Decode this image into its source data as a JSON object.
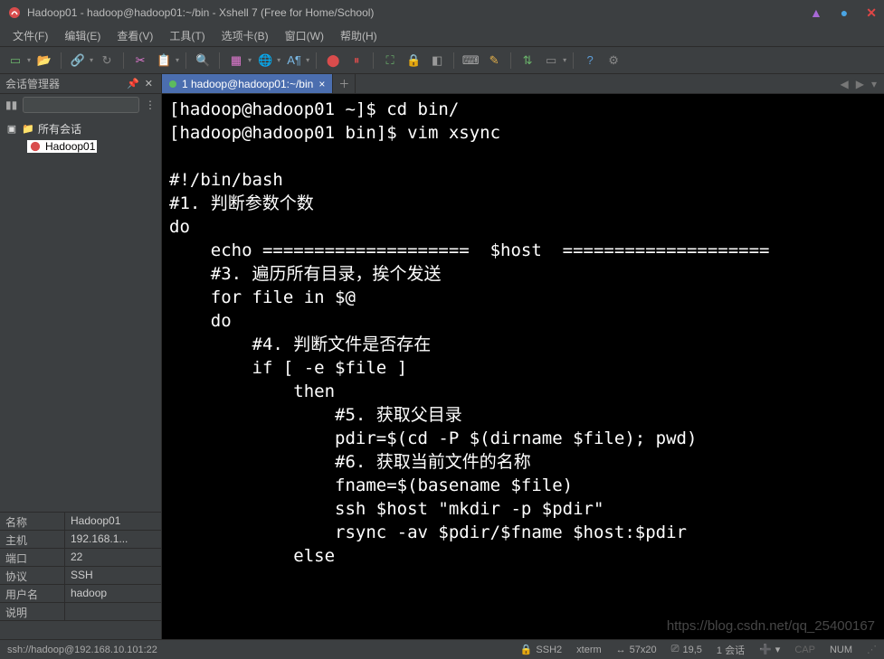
{
  "titlebar": {
    "title": "Hadoop01 - hadoop@hadoop01:~/bin - Xshell 7 (Free for Home/School)"
  },
  "menu": {
    "file": "文件(F)",
    "edit": "编辑(E)",
    "view": "查看(V)",
    "tools": "工具(T)",
    "tabs": "选项卡(B)",
    "window": "窗口(W)",
    "help": "帮助(H)"
  },
  "sidebar": {
    "title": "会话管理器",
    "root": "所有会话",
    "session": "Hadoop01"
  },
  "props": {
    "name_k": "名称",
    "name_v": "Hadoop01",
    "host_k": "主机",
    "host_v": "192.168.1...",
    "port_k": "端口",
    "port_v": "22",
    "proto_k": "协议",
    "proto_v": "SSH",
    "user_k": "用户名",
    "user_v": "hadoop",
    "desc_k": "说明",
    "desc_v": ""
  },
  "tab": {
    "label": "1 hadoop@hadoop01:~/bin"
  },
  "terminal_lines": [
    "[hadoop@hadoop01 ~]$ cd bin/",
    "[hadoop@hadoop01 bin]$ vim xsync",
    "",
    "#!/bin/bash",
    "#1. 判断参数个数",
    "do",
    "    echo ====================  $host  ====================",
    "    #3. 遍历所有目录，挨个发送",
    "    for file in $@",
    "    do",
    "        #4. 判断文件是否存在",
    "        if [ -e $file ]",
    "            then",
    "                #5. 获取父目录",
    "                pdir=$(cd -P $(dirname $file); pwd)",
    "                #6. 获取当前文件的名称",
    "                fname=$(basename $file)",
    "                ssh $host \"mkdir -p $pdir\"",
    "                rsync -av $pdir/$fname $host:$pdir",
    "            else"
  ],
  "status": {
    "conn": "ssh://hadoop@192.168.10.101:22",
    "ssh": "SSH2",
    "term": "xterm",
    "size": "57x20",
    "pos": "19,5",
    "sessions": "1 会话",
    "cap": "CAP",
    "num": "NUM"
  },
  "watermark": "https://blog.csdn.net/qq_25400167"
}
